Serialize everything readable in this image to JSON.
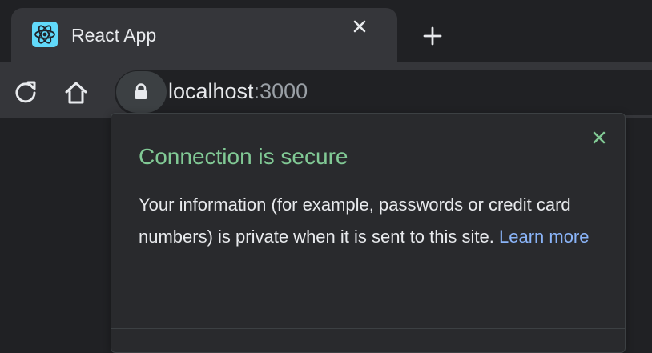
{
  "browser": {
    "tab": {
      "title": "React App",
      "favicon": "react-logo-icon",
      "close_icon": "close-icon"
    },
    "new_tab_icon": "plus-icon",
    "toolbar": {
      "reload_icon": "reload-icon",
      "home_icon": "home-icon",
      "lock_icon": "lock-icon",
      "url_host": "localhost",
      "url_port": ":3000"
    }
  },
  "security_popup": {
    "title": "Connection is secure",
    "body": "Your information (for example, passwords or credit card numbers) is private when it is sent to this site.",
    "learn_more": "Learn more",
    "close_icon": "close-icon"
  },
  "colors": {
    "background": "#202124",
    "toolbar": "#35363a",
    "title_green": "#81c995",
    "link_blue": "#8ab4f8"
  }
}
